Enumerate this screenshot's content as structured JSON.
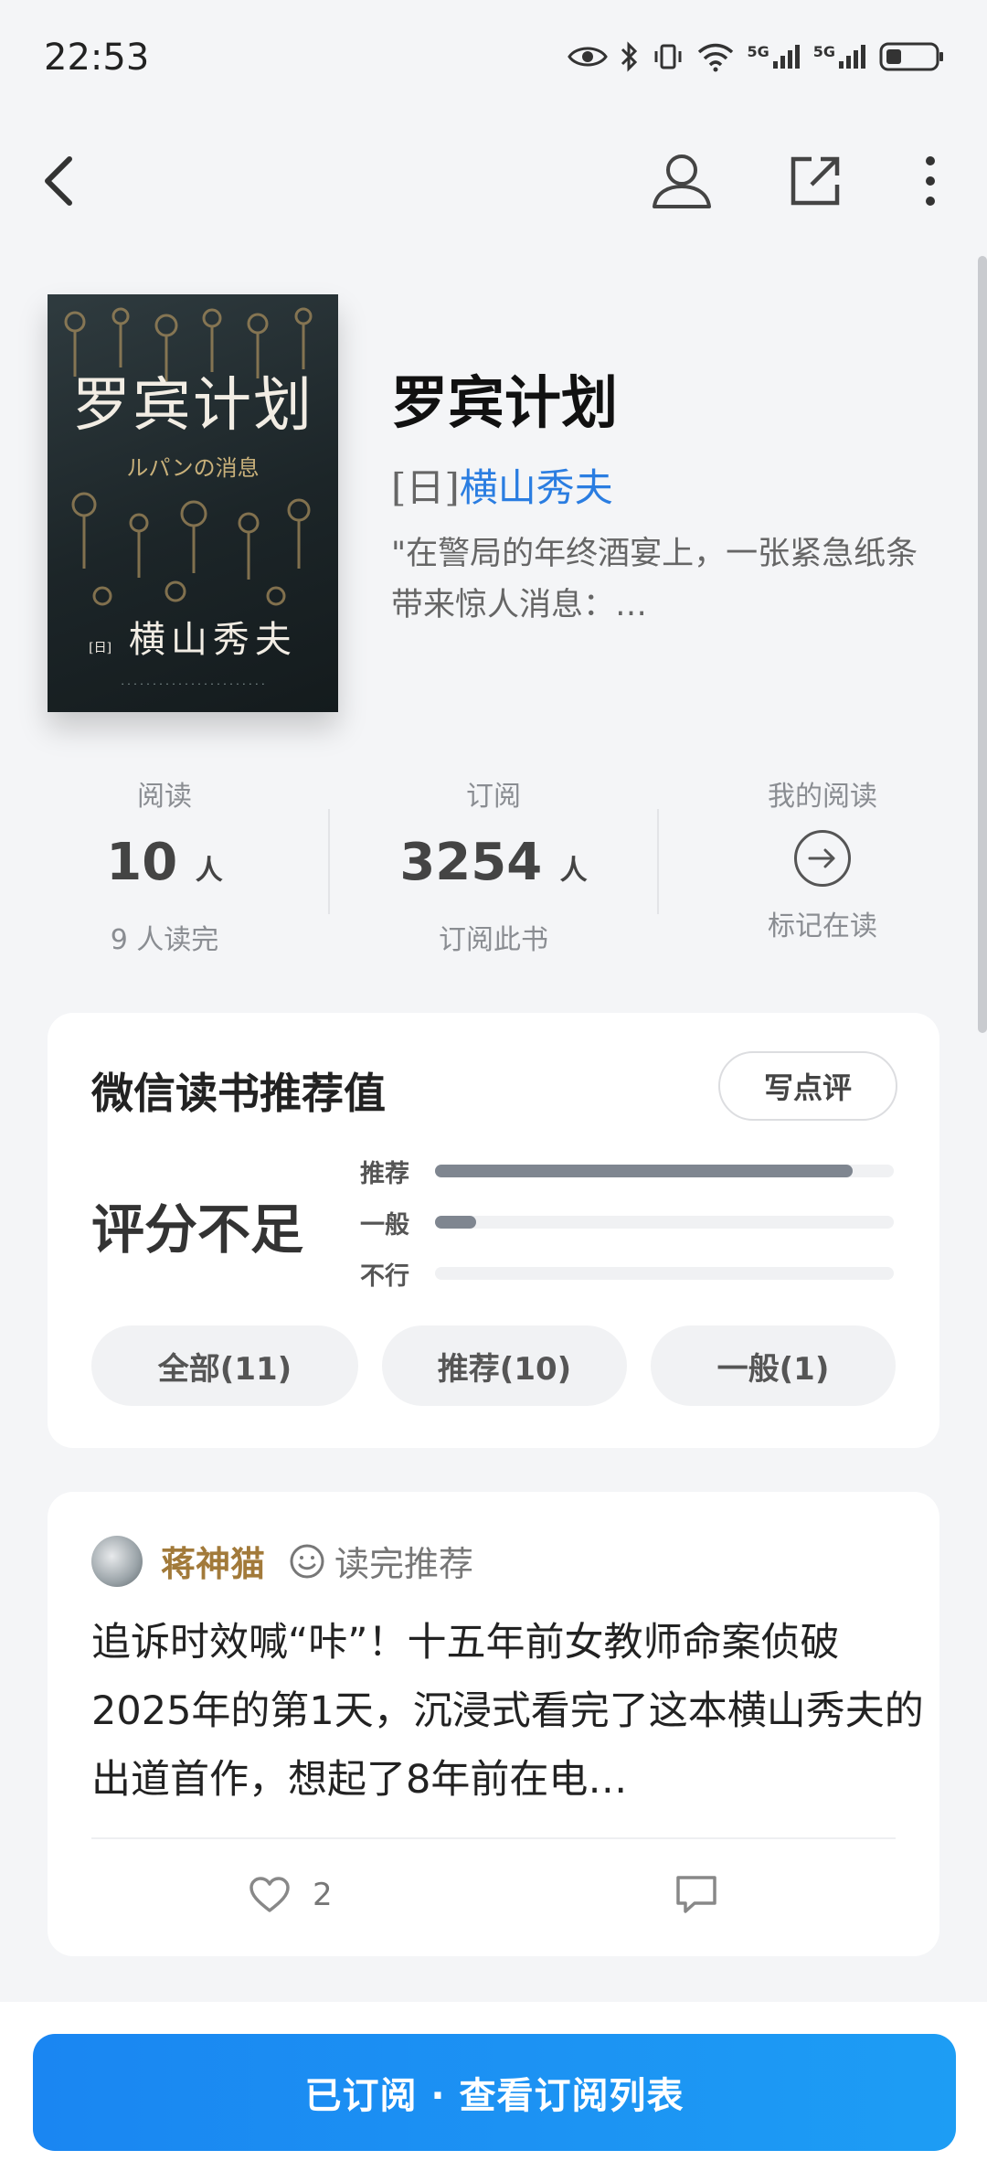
{
  "status_bar": {
    "time": "22:53",
    "network_1": "5G",
    "network_2": "5G"
  },
  "nav": {
    "back_icon": "chevron-left-icon",
    "profile_icon": "user-icon",
    "share_icon": "external-link-icon",
    "more_icon": "more-vertical-icon"
  },
  "book": {
    "cover_title": "罗宾计划",
    "cover_subtitle": "ルパンの消息",
    "cover_author": "横山秀夫",
    "cover_author_prefix": "[日]",
    "title": "罗宾计划",
    "author_prefix": "[日]",
    "author_name": "横山秀夫",
    "intro": "\"在警局的年终酒宴上，一张紧急纸条带来惊人消息：…"
  },
  "stats": {
    "read": {
      "label": "阅读",
      "value": "10",
      "unit": "人",
      "sub": "9 人读完"
    },
    "subscribe": {
      "label": "订阅",
      "value": "3254",
      "unit": "人",
      "sub": "订阅此书"
    },
    "my_reading": {
      "label": "我的阅读",
      "sub": "标记在读"
    }
  },
  "recommend": {
    "title": "微信读书推荐值",
    "write_label": "写点评",
    "score_text": "评分不足",
    "bars": [
      {
        "label": "推荐",
        "fraction": 0.91
      },
      {
        "label": "一般",
        "fraction": 0.09
      },
      {
        "label": "不行",
        "fraction": 0.0
      }
    ],
    "filters": [
      "全部(11)",
      "推荐(10)",
      "一般(1)"
    ]
  },
  "review": {
    "reviewer": "蒋神猫",
    "tag": "读完推荐",
    "text": "追诉时效喊“咔”！十五年前女教师命案侦破 2025年的第1天，沉浸式看完了这本横山秀夫的出道首作，想起了8年前在电…",
    "likes": "2"
  },
  "cta": {
    "label": "已订阅 · 查看订阅列表"
  },
  "colors": {
    "accent": "#1a86f2",
    "author_link": "#2a7de1",
    "reviewer_name": "#a27a3a"
  }
}
